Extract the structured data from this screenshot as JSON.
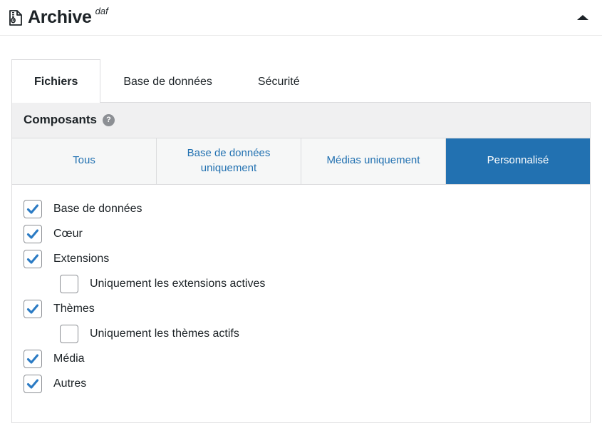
{
  "header": {
    "title": "Archive",
    "suffix": "daf",
    "icon": "archive-file-icon",
    "collapse_icon": "caret-up-icon"
  },
  "tabs": [
    {
      "label": "Fichiers",
      "active": true
    },
    {
      "label": "Base de données",
      "active": false
    },
    {
      "label": "Sécurité",
      "active": false
    }
  ],
  "section": {
    "title": "Composants",
    "help_icon": "help-icon",
    "help_glyph": "?"
  },
  "segmented": [
    {
      "label": "Tous",
      "active": false
    },
    {
      "label": "Base de données uniquement",
      "active": false
    },
    {
      "label": "Médias uniquement",
      "active": false
    },
    {
      "label": "Personnalisé",
      "active": true
    }
  ],
  "components": [
    {
      "label": "Base de données",
      "checked": true,
      "sub": false
    },
    {
      "label": "Cœur",
      "checked": true,
      "sub": false
    },
    {
      "label": "Extensions",
      "checked": true,
      "sub": false
    },
    {
      "label": "Uniquement les extensions actives",
      "checked": false,
      "sub": true
    },
    {
      "label": "Thèmes",
      "checked": true,
      "sub": false
    },
    {
      "label": "Uniquement les thèmes actifs",
      "checked": false,
      "sub": true
    },
    {
      "label": "Média",
      "checked": true,
      "sub": false
    },
    {
      "label": "Autres",
      "checked": true,
      "sub": false
    }
  ],
  "colors": {
    "accent": "#2271b1",
    "text": "#1d2327",
    "border": "#dcdcde",
    "header_bg": "#f0f0f1",
    "segment_bg": "#f6f7f7",
    "check_mark": "#2b7bc4"
  }
}
